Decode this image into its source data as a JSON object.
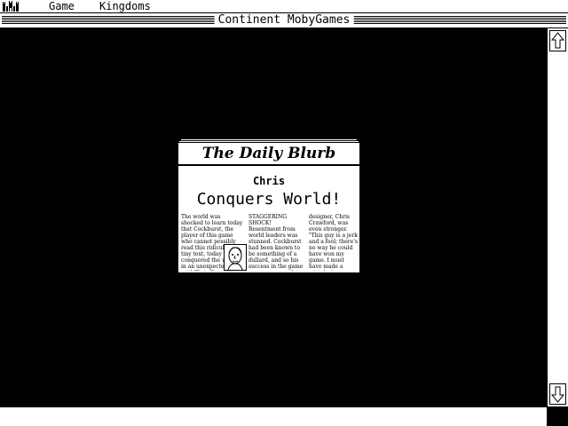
{
  "menubar": {
    "app_icon": "castle-icon",
    "items": [
      {
        "label": "Game"
      },
      {
        "label": "Kingdoms"
      }
    ]
  },
  "window": {
    "title": "Continent MobyGames"
  },
  "scrollbar": {
    "up_icon": "arrow-up-icon",
    "down_icon": "arrow-down-icon"
  },
  "newspaper": {
    "masthead": "The Daily Blurb",
    "headline_name": "Chris",
    "headline_main": "Conquers World!",
    "portrait_icon": "face-portrait-icon",
    "columns": [
      "The world was shocked to learn today that Cockburst, the player of this game who cannot possibly read this ridiculously tiny text, today conquered the world in an unexpected level said Chris Crawford, game's designer. Cockburst",
      "STAGGERING SHOCK! Resentment from world leaders was stunned. Cockburst had been known to be something of a dullard, and so his success in the game came as a complete surprise to those in the know. \"We didn't think he had it in him\",",
      "designer, Chris Crawford, was even stronger. \"This guy is a jerk and a fool; there's no way he could have won my game. I must have made a mistake in programming. I'm going to go back and"
    ]
  }
}
